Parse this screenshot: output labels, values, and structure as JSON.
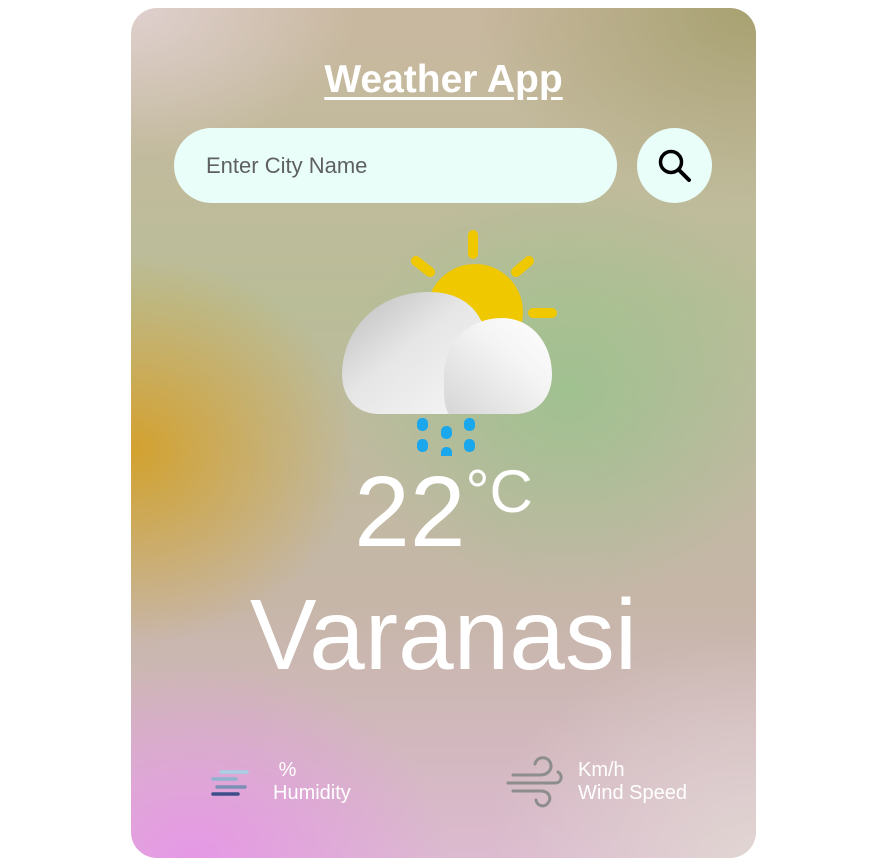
{
  "app": {
    "title": "Weather App"
  },
  "search": {
    "placeholder": "Enter City Name",
    "value": "",
    "button_icon": "search-icon"
  },
  "weather": {
    "icon": "sun-cloud-rain-icon",
    "temperature": "22",
    "temperature_unit": "°C",
    "city": "Varanasi"
  },
  "details": {
    "humidity": {
      "icon": "humidity-icon",
      "value": "",
      "unit": "%",
      "label": "Humidity"
    },
    "wind": {
      "icon": "wind-icon",
      "value": "",
      "unit": "Km/h",
      "label": "Wind Speed"
    }
  },
  "colors": {
    "input_background": "#e9fdf9",
    "text": "#ffffff",
    "sun": "#f0c800",
    "rain": "#1aa7ec"
  }
}
